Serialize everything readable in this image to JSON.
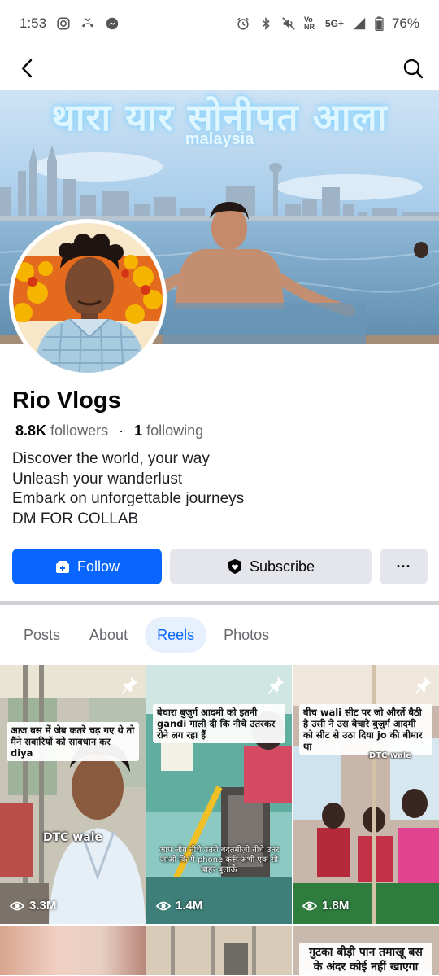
{
  "status_bar": {
    "time": "1:53",
    "network": "5G+",
    "volte": "Vo NR",
    "battery": "76%"
  },
  "nav": {
    "back_icon": "arrow-left-icon",
    "search_icon": "search-icon"
  },
  "cover": {
    "title": "थारा यार सोनीपत आला",
    "subtitle": "malaysia"
  },
  "profile": {
    "name": "Rio Vlogs",
    "followers_count": "8.8K",
    "followers_label": "followers",
    "following_count": "1",
    "following_label": "following",
    "bio": [
      "Discover the world, your way",
      "Unleash your wanderlust",
      "Embark on unforgettable journeys",
      "DM FOR COLLAB"
    ]
  },
  "actions": {
    "follow_label": "Follow",
    "subscribe_label": "Subscribe",
    "more_label": "···"
  },
  "tabs": [
    {
      "label": "Posts",
      "active": false
    },
    {
      "label": "About",
      "active": false
    },
    {
      "label": "Reels",
      "active": true
    },
    {
      "label": "Photos",
      "active": false
    }
  ],
  "reels": [
    {
      "caption": "आज बस में जेब कतरे चढ़ गए थे तो मैंने सवारियों को सावधान कर diya",
      "overlay": "DTC wale",
      "views": "3.3M",
      "pinned": true
    },
    {
      "caption": "बेचारा बुज़ुर्ग आदमी को इतनी gandi गाली दी कि नीचे उतरकर रोने लग रहा हैं",
      "overlay": "आप लोग नीचे उतरो बदतमीज़ी नीचे उतर जाओ कि मैं phone करूँ अभी एक सौ बाहर बुलाऊँ",
      "views": "1.4M",
      "pinned": true
    },
    {
      "caption": "बीच wali सीट पर जो औरतें बैठी है उसी ने उस बेचारे बुज़ुर्ग आदमी को सीट से उठा दिया jo की बीमार था",
      "overlay": "DTC wale",
      "views": "1.8M",
      "pinned": true
    },
    {
      "caption": "",
      "overlay": "",
      "views": "",
      "pinned": false
    },
    {
      "caption": "",
      "overlay": "",
      "views": "",
      "pinned": false
    },
    {
      "caption": "गुटका बीड़ी पान तमाखू बस के अंदर कोई नहीं खाएगा",
      "overlay": "",
      "views": "",
      "pinned": false
    }
  ],
  "colors": {
    "accent": "#0866ff",
    "button_gray": "#e4e6eb",
    "tab_active_bg": "#e7f0fd",
    "secondary_text": "#65676b"
  }
}
